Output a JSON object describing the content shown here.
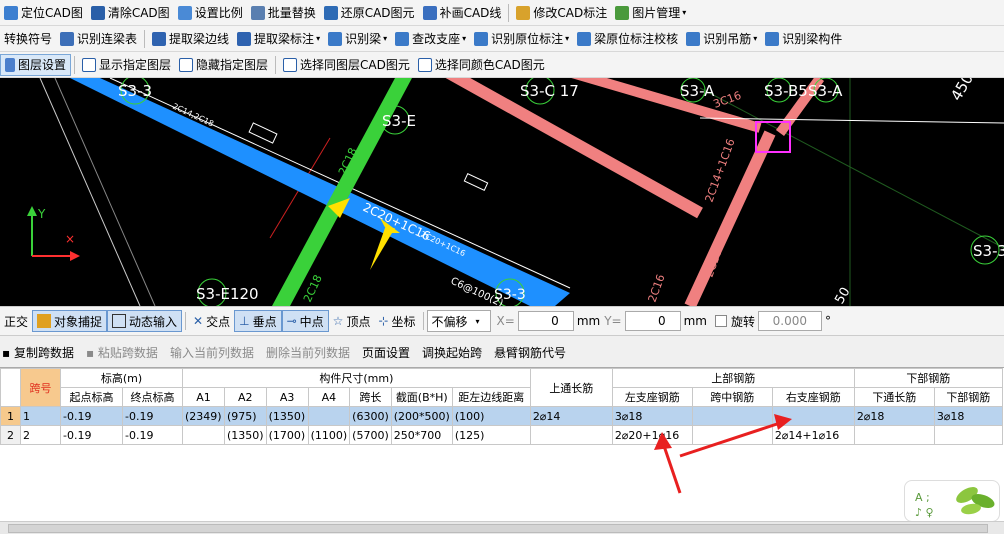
{
  "toolbar1": {
    "items": [
      "定位CAD图",
      "清除CAD图",
      "设置比例",
      "批量替换",
      "还原CAD图元",
      "补画CAD线",
      "修改CAD标注",
      "图片管理"
    ]
  },
  "toolbar2": {
    "items": [
      "转换符号",
      "识别连梁表",
      "提取梁边线",
      "提取梁标注",
      "识别梁",
      "查改支座",
      "识别原位标注",
      "梁原位标注校核",
      "识别吊筋",
      "识别梁构件"
    ]
  },
  "toolbar3": {
    "items": [
      "图层设置",
      "显示指定图层",
      "隐藏指定图层",
      "选择同图层CAD图元",
      "选择同颜色CAD图元"
    ]
  },
  "canvas": {
    "labels": {
      "s3_3_left": "S3-3",
      "s3_e_top": "S3-E",
      "s3_c17": "S3-C 17",
      "s3_a_right": "S3-A",
      "s3_b5": "S3-B5",
      "s3_a_far": "S3-A",
      "s3_3_right": "S3-3",
      "s3_e_bottom": "S3-E120",
      "s3_3_mid": "S3-3",
      "num_450": "450",
      "num_50": "50",
      "beam_main": "2C20+1C16",
      "beam_sub": "2C20+1C16",
      "c18_a": "2C18",
      "c18_b": "2C18",
      "c16_a": "2C16",
      "c16_b": "2C16",
      "c14_c16": "2C14+1C16",
      "c16_top": "3C16",
      "c6_stirrup": "C6@100(2)",
      "leader_small": "2C14,2C18",
      "axis_y": "Y"
    }
  },
  "snapbar": {
    "ortho": "正交",
    "osnap": "对象捕捉",
    "dyn": "动态输入",
    "intersect": "交点",
    "perp": "垂点",
    "mid": "中点",
    "vertex": "顶点",
    "coord": "坐标",
    "offset": "不偏移",
    "x_label": "X=",
    "x_value": "0",
    "y_label": "Y=",
    "y_value": "0",
    "unit": "mm",
    "rotate": "旋转",
    "rotate_value": "0.000",
    "deg": "°"
  },
  "actbar": {
    "copy": "复制跨数据",
    "paste": "粘贴跨数据",
    "input_col": "输入当前列数据",
    "delete_col": "删除当前列数据",
    "page_setup": "页面设置",
    "swap_start": "调换起始跨",
    "cantilever": "悬臂钢筋代号"
  },
  "table": {
    "hdr": {
      "span": "跨号",
      "elev": "标高(m)",
      "start_elev": "起点标高",
      "end_elev": "终点标高",
      "dims": "构件尺寸(mm)",
      "a1": "A1",
      "a2": "A2",
      "a3": "A3",
      "a4": "A4",
      "span_len": "跨长",
      "section": "截面(B*H)",
      "offset": "距左边线距离",
      "top_cont": "上通长筋",
      "top_bars": "上部钢筋",
      "left_sup": "左支座钢筋",
      "mid_span": "跨中钢筋",
      "right_sup": "右支座钢筋",
      "bottom_bars": "下部钢筋",
      "bot_cont": "下通长筋",
      "bot_bar": "下部钢筋"
    },
    "rows": [
      {
        "idx": "1",
        "span": "1",
        "start": "-0.19",
        "end": "-0.19",
        "a1": "(2349)",
        "a2": "(975)",
        "a3": "(1350)",
        "a4": "",
        "len": "(6300)",
        "sec": "(200*500)",
        "off": "(100)",
        "top": "2⌀14",
        "left": "3⌀18",
        "mid": "",
        "right": "",
        "botc": "2⌀18",
        "bot": "3⌀18"
      },
      {
        "idx": "2",
        "span": "2",
        "start": "-0.19",
        "end": "-0.19",
        "a1": "",
        "a2": "(1350)",
        "a3": "(1700)",
        "a4": "(1100)",
        "len": "(5700)",
        "sec": "250*700",
        "off": "(125)",
        "top": "",
        "left": "2⌀20+1⌀16",
        "mid": "",
        "right": "2⌀14+1⌀16",
        "botc": "",
        "bot": ""
      }
    ]
  }
}
